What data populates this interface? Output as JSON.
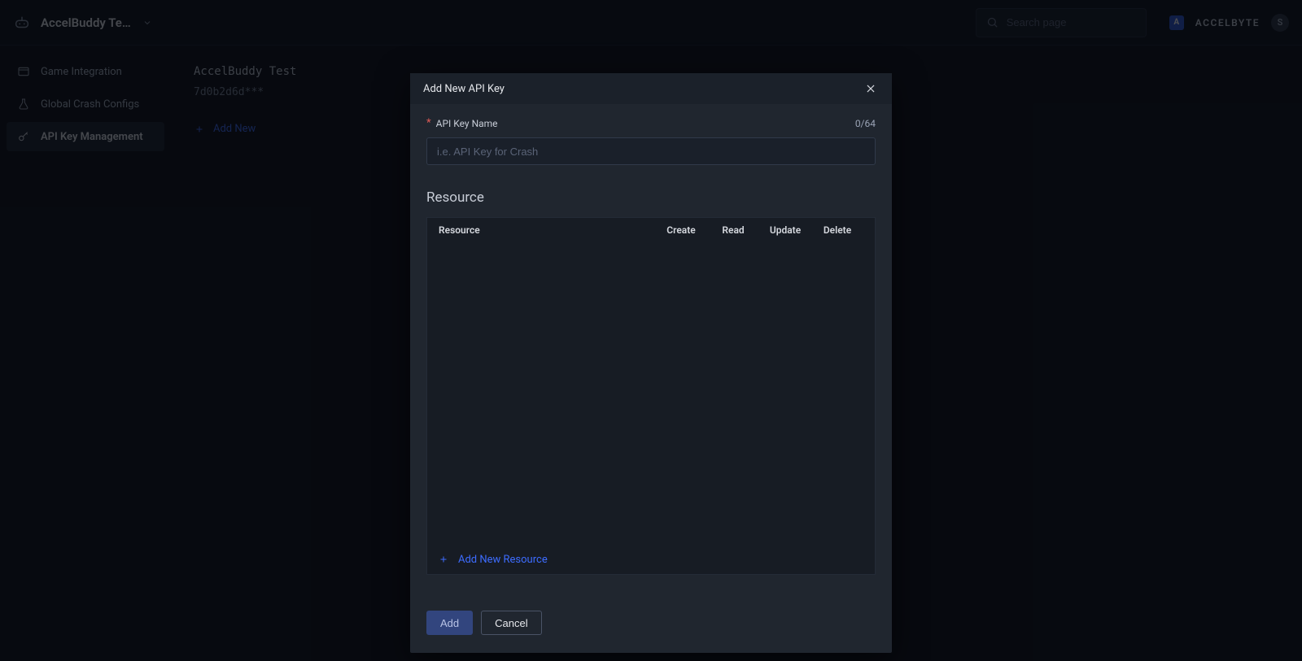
{
  "topbar": {
    "title": "AccelBuddy Te…",
    "search_placeholder": "Search page",
    "brand_initial": "A",
    "brand_text": "ACCELBYTE",
    "avatar_initial": "S"
  },
  "sidebar": {
    "items": [
      {
        "label": "Game Integration"
      },
      {
        "label": "Global Crash Configs"
      },
      {
        "label": "API Key Management"
      }
    ]
  },
  "main": {
    "title": "AccelBuddy Test",
    "subtitle": "7d0b2d6d***",
    "add_new_label": "Add New"
  },
  "modal": {
    "title": "Add New API Key",
    "field_label": "API Key Name",
    "counter": "0/64",
    "input_placeholder": "i.e. API Key for Crash",
    "section_title": "Resource",
    "columns": {
      "resource": "Resource",
      "create": "Create",
      "read": "Read",
      "update": "Update",
      "delete": "Delete"
    },
    "add_resource_label": "Add New Resource",
    "actions": {
      "add": "Add",
      "cancel": "Cancel"
    }
  }
}
